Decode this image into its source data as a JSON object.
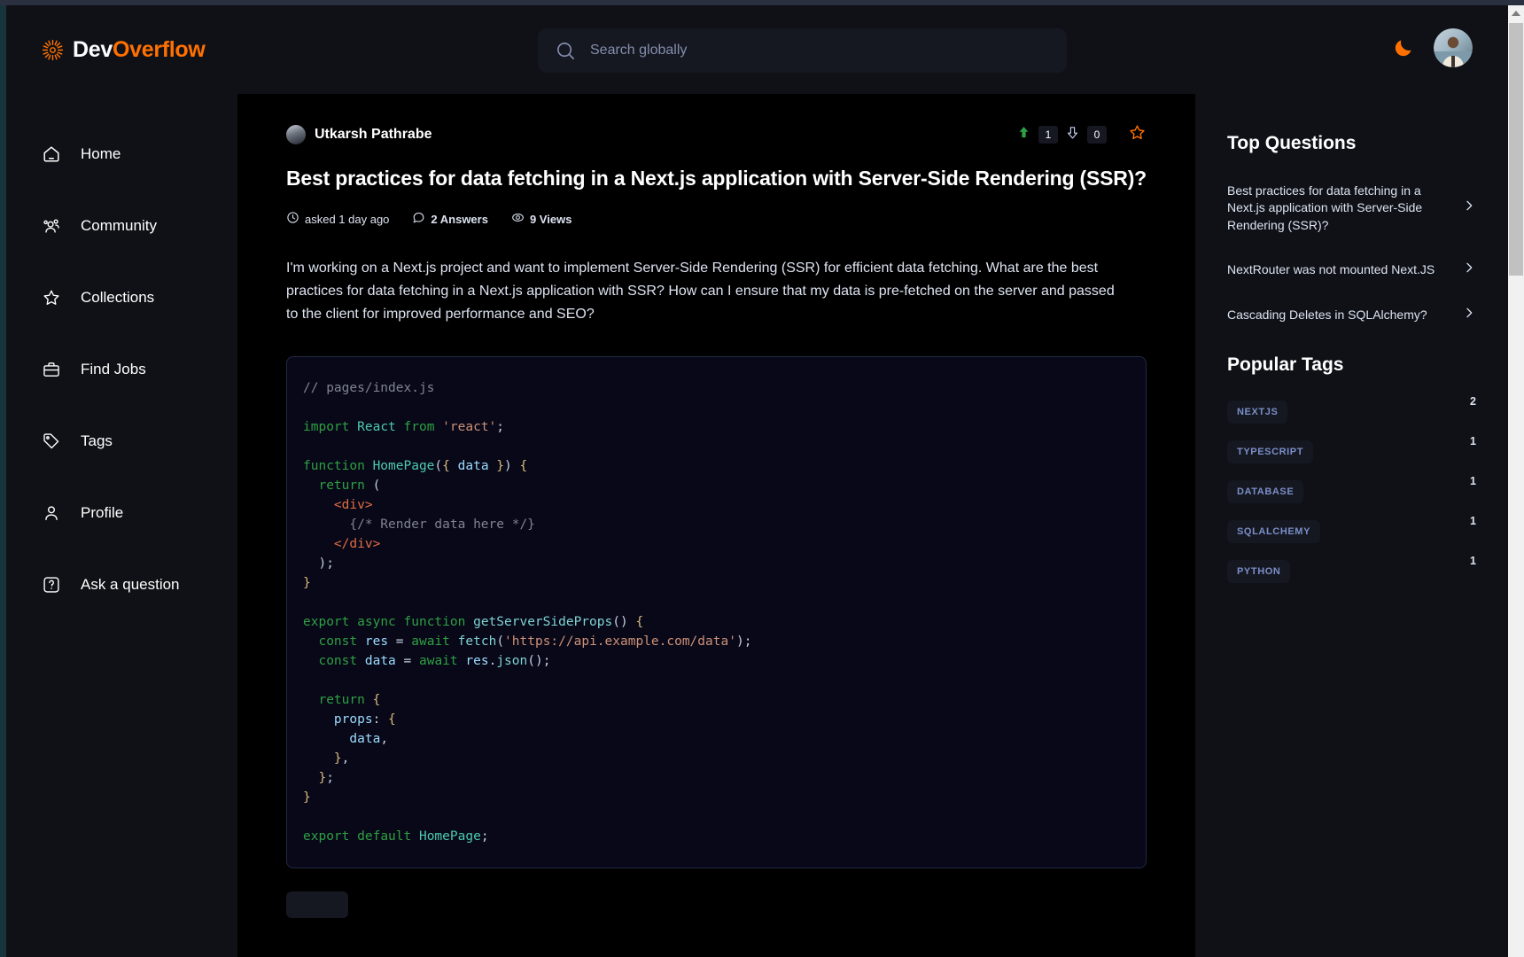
{
  "brand": {
    "logo_icon": "sun-icon",
    "name_first": "Dev",
    "name_second": "Overflow"
  },
  "search": {
    "icon": "search-icon",
    "placeholder": "Search globally",
    "value": ""
  },
  "nav_right": {
    "theme_toggle_icon": "moon-icon",
    "avatar_icon": "user-avatar"
  },
  "sidebar": {
    "items": [
      {
        "label": "Home",
        "icon": "home-icon"
      },
      {
        "label": "Community",
        "icon": "users-icon"
      },
      {
        "label": "Collections",
        "icon": "star-icon"
      },
      {
        "label": "Find Jobs",
        "icon": "briefcase-icon"
      },
      {
        "label": "Tags",
        "icon": "tag-icon"
      },
      {
        "label": "Profile",
        "icon": "user-icon"
      },
      {
        "label": "Ask a question",
        "icon": "question-icon"
      }
    ]
  },
  "question": {
    "author": "Utkarsh Pathrabe",
    "upvotes": "1",
    "downvotes": "0",
    "title": "Best practices for data fetching in a Next.js application with Server-Side Rendering (SSR)?",
    "meta": {
      "asked": "asked 1 day ago",
      "answers": "2 Answers",
      "views": "9 Views"
    },
    "body": "I'm working on a Next.js project and want to implement Server-Side Rendering (SSR) for efficient data fetching. What are the best practices for data fetching in a Next.js application with SSR? How can I ensure that my data is pre-fetched on the server and passed to the client for improved performance and SEO?",
    "code": "// pages/index.js\n\nimport React from 'react';\n\nfunction HomePage({ data }) {\n  return (\n    <div>\n      {/* Render data here */}\n    </div>\n  );\n}\n\nexport async function getServerSideProps() {\n  const res = await fetch('https://api.example.com/data');\n  const data = await res.json();\n\n  return {\n    props: {\n      data,\n    },\n  };\n}\n\nexport default HomePage;"
  },
  "right_sidebar": {
    "top_questions_title": "Top Questions",
    "top_questions": [
      "Best practices for data fetching in a Next.js application with Server-Side Rendering (SSR)?",
      "NextRouter was not mounted Next.JS",
      "Cascading Deletes in SQLAlchemy?"
    ],
    "popular_tags_title": "Popular Tags",
    "popular_tags": [
      {
        "name": "NEXTJS",
        "count": "2"
      },
      {
        "name": "TYPESCRIPT",
        "count": "1"
      },
      {
        "name": "DATABASE",
        "count": "1"
      },
      {
        "name": "SQLALCHEMY",
        "count": "1"
      },
      {
        "name": "PYTHON",
        "count": "1"
      }
    ]
  },
  "colors": {
    "accent_orange": "#FF7000",
    "page_bg": "#0F1117",
    "card_bg": "#000000",
    "text_primary": "#FFFFFF",
    "text_secondary": "#DCE3F1",
    "tag_text": "#7B8EC8",
    "upvote_green": "#2ea043"
  }
}
